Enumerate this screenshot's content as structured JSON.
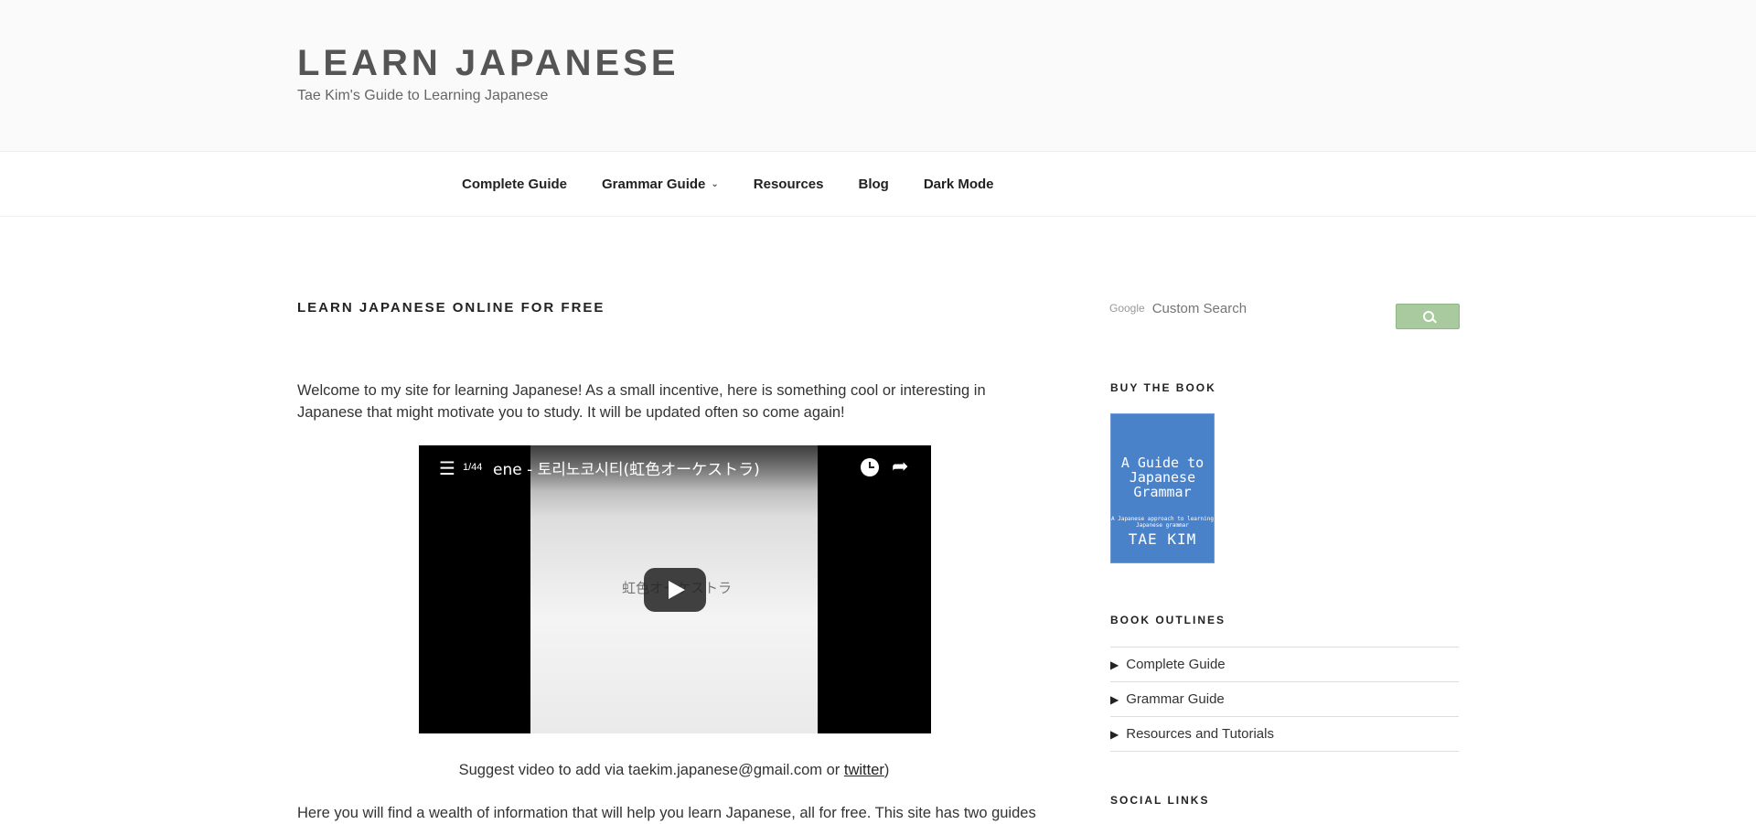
{
  "header": {
    "title": "LEARN JAPANESE",
    "tagline": "Tae Kim's Guide to Learning Japanese"
  },
  "nav": {
    "items": [
      {
        "label": "Complete Guide"
      },
      {
        "label": "Grammar Guide",
        "has_dropdown": true
      },
      {
        "label": "Resources"
      },
      {
        "label": "Blog"
      },
      {
        "label": "Dark Mode"
      }
    ]
  },
  "main": {
    "heading": "LEARN JAPANESE ONLINE FOR FREE",
    "intro": "Welcome to my site for learning Japanese! As a small incentive, here is something cool or interesting in Japanese that might motivate you to study. It will be updated often so come again!",
    "video": {
      "playlist_count": "1/44",
      "title": "ene - 토리노코시티(虹色オーケストラ)",
      "watermark": "虹色オーケストラ"
    },
    "suggest_prefix": "Suggest video to add via taekim.japanese@gmail.com or ",
    "suggest_link": "twitter",
    "suggest_suffix": ")",
    "wealth": "Here you will find a wealth of information that will help you learn Japanese, all for free. This site has two guides"
  },
  "sidebar": {
    "search": {
      "brand": "Google",
      "placeholder": "Custom Search"
    },
    "buy_title": "BUY THE BOOK",
    "book": {
      "title": "A Guide to Japanese Grammar",
      "subtitle": "A Japanese approach to learning Japanese grammar",
      "author": "TAE KIM"
    },
    "outlines_title": "BOOK OUTLINES",
    "outlines": [
      {
        "label": "Complete Guide"
      },
      {
        "label": "Grammar Guide"
      },
      {
        "label": "Resources and Tutorials"
      }
    ],
    "social_title": "SOCIAL LINKS"
  },
  "colors": {
    "header_bg": "#fafafa",
    "search_button": "#a9c99f",
    "book_cover": "#4a82c9"
  },
  "icons": [
    "playlist-icon",
    "clock-icon",
    "share-icon",
    "play-icon",
    "search-icon",
    "triangle-right-icon",
    "chevron-down-icon"
  ]
}
